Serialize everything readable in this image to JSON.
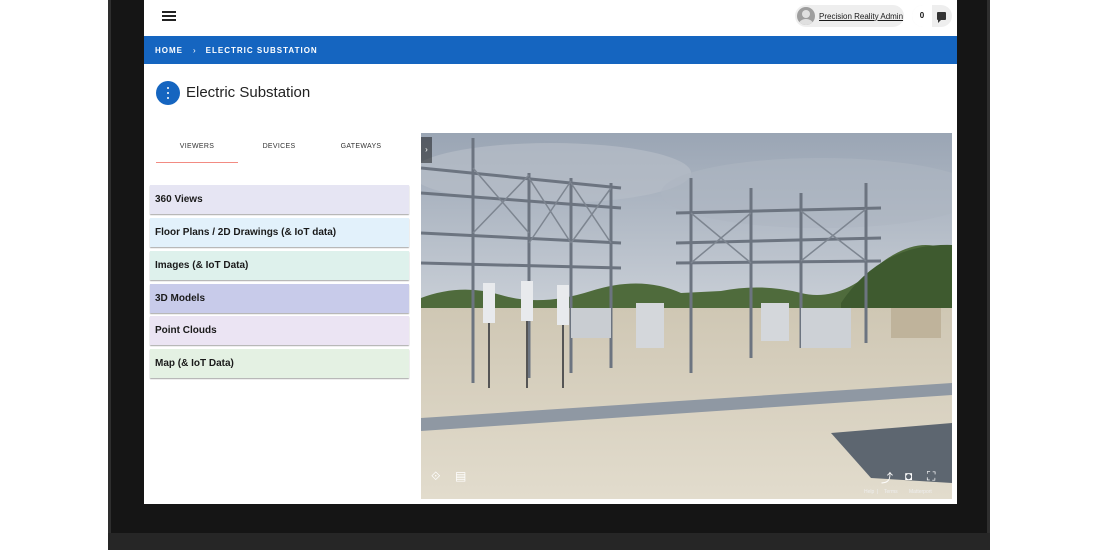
{
  "user": {
    "name": "Precision Reality Admin"
  },
  "messages": {
    "count": "0"
  },
  "breadcrumb": {
    "home": "HOME",
    "separator": "›",
    "current": "ELECTRIC SUBSTATION"
  },
  "page": {
    "title": "Electric Substation"
  },
  "tabs": [
    {
      "label": "VIEWERS"
    },
    {
      "label": "DEVICES"
    },
    {
      "label": "GATEWAYS"
    }
  ],
  "viewer_list": [
    {
      "label": "360 Views",
      "color": "#e6e5f3"
    },
    {
      "label": "Floor Plans / 2D Drawings (& IoT data)",
      "color": "#e2f1fb"
    },
    {
      "label": "Images (& IoT Data)",
      "color": "#def1ec"
    },
    {
      "label": "3D Models",
      "color": "#c8cbea"
    },
    {
      "label": "Point Clouds",
      "color": "#ebe4f3"
    },
    {
      "label": "Map (& IoT Data)",
      "color": "#e4f1e3"
    }
  ],
  "viewer": {
    "toggle": "›",
    "footer": {
      "help": "Help",
      "divider": "|",
      "terms": "Terms",
      "brand": "Matterport"
    }
  },
  "colors": {
    "brand": "#1565c0",
    "tab_indicator": "#f28b82"
  }
}
